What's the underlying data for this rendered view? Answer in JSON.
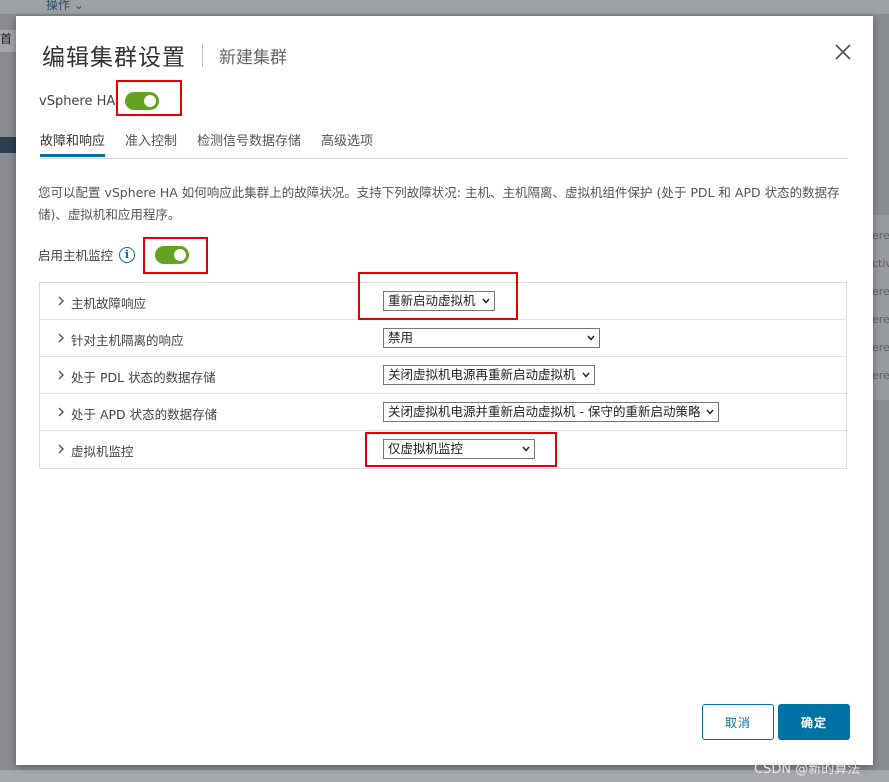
{
  "background": {
    "menu_label": "操作",
    "tab_chip": "首",
    "right_fragments": [
      "ere",
      "ctiv",
      "ere",
      "ere",
      "ere",
      "ere"
    ]
  },
  "dialog": {
    "title": "编辑集群设置",
    "subtitle": "新建集群",
    "vsphere_ha_label": "vSphere HA",
    "vsphere_ha_enabled": true,
    "tabs": [
      {
        "label": "故障和响应",
        "active": true
      },
      {
        "label": "准入控制",
        "active": false
      },
      {
        "label": "检测信号数据存储",
        "active": false
      },
      {
        "label": "高级选项",
        "active": false
      }
    ],
    "description": "您可以配置 vSphere HA 如何响应此集群上的故障状况。支持下列故障状况: 主机、主机隔离、虚拟机组件保护 (处于 PDL 和 APD 状态的数据存储)、虚拟机和应用程序。",
    "host_monitoring_label": "启用主机监控",
    "host_monitoring_enabled": true,
    "rows": [
      {
        "label": "主机故障响应",
        "value": "重新启动虚拟机"
      },
      {
        "label": "针对主机隔离的响应",
        "value": "禁用"
      },
      {
        "label": "处于 PDL 状态的数据存储",
        "value": "关闭虚拟机电源再重新启动虚拟机"
      },
      {
        "label": "处于 APD 状态的数据存储",
        "value": "关闭虚拟机电源并重新启动虚拟机 - 保守的重新启动策略"
      },
      {
        "label": "虚拟机监控",
        "value": "仅虚拟机监控"
      }
    ],
    "cancel_label": "取消",
    "ok_label": "确定"
  },
  "colors": {
    "accent": "#0072a3",
    "toggle_on": "#62a420",
    "highlight": "#e60000"
  },
  "watermark": "CSDN @新的算法"
}
